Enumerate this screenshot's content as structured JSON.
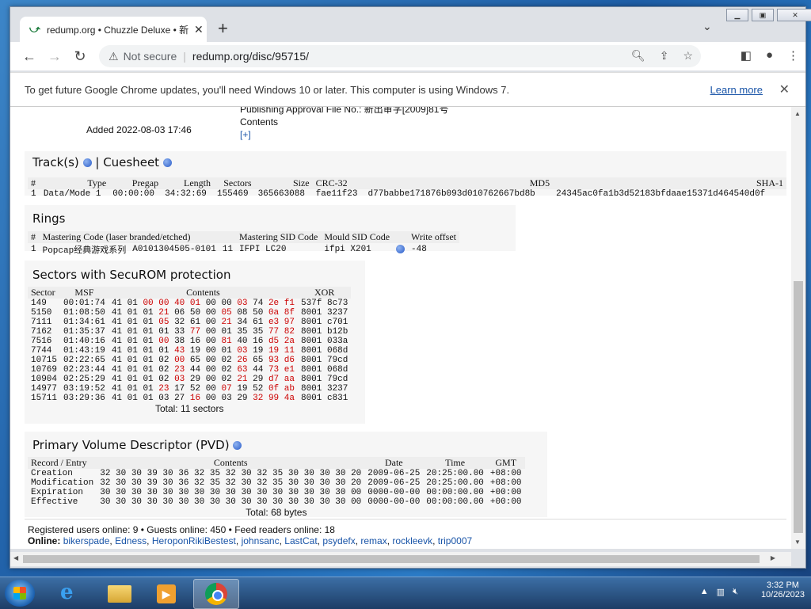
{
  "browser": {
    "tab_title": "redump.org • Chuzzle Deluxe • 新",
    "not_secure": "Not secure",
    "url": "redump.org/disc/95715/",
    "info_message": "To get future Google Chrome updates, you'll need Windows 10 or later. This computer is using Windows 7.",
    "learn_more": "Learn more"
  },
  "header_partial": {
    "publishing": "Publishing Approval File No.: 新出审字[2009]81号",
    "added_label": "Added",
    "added_value": "2022-08-03 17:46",
    "contents_label": "Contents",
    "contents_toggle": "[+]"
  },
  "tracks": {
    "title": "Track(s)",
    "sep": "|",
    "cuesheet": "Cuesheet",
    "headers": [
      "#",
      "Type",
      "Pregap",
      "Length",
      "Sectors",
      "Size",
      "CRC-32",
      "MD5",
      "SHA-1"
    ],
    "rows": [
      [
        "1",
        "Data/Mode 1",
        "00:00:00",
        "34:32:69",
        "155469",
        "365663088",
        "fae11f23",
        "d77babbe171876b093d010762667bd8b",
        "24345ac0fa1b3d52183bfdaae15371d464540d0f"
      ]
    ]
  },
  "rings": {
    "title": "Rings",
    "headers": [
      "#",
      "Mastering Code (laser branded/etched)",
      "",
      "",
      "Mastering SID Code",
      "Mould SID Code",
      "",
      "Write offset"
    ],
    "rows": [
      [
        "1",
        "Popcap经典游戏系列",
        "A0101304505-0101",
        "11",
        "IFPI LC20",
        "ifpi X201",
        "",
        "-48"
      ]
    ]
  },
  "securom": {
    "title": "Sectors with SecuROM protection",
    "headers": [
      "Sector",
      "MSF",
      "Contents",
      "XOR"
    ],
    "rows": [
      {
        "sector": "149",
        "msf": "00:01:74",
        "c": [
          [
            "41",
            0
          ],
          [
            "01",
            0
          ],
          [
            "00",
            1
          ],
          [
            "00",
            1
          ],
          [
            "40",
            1
          ],
          [
            "01",
            1
          ],
          [
            "00",
            0
          ],
          [
            "00",
            0
          ],
          [
            "03",
            1
          ],
          [
            "74",
            0
          ],
          [
            "2e",
            1
          ],
          [
            "f1",
            1
          ]
        ],
        "xor": "537f 8c73"
      },
      {
        "sector": "5150",
        "msf": "01:08:50",
        "c": [
          [
            "41",
            0
          ],
          [
            "01",
            0
          ],
          [
            "01",
            0
          ],
          [
            "21",
            1
          ],
          [
            "06",
            0
          ],
          [
            "50",
            0
          ],
          [
            "00",
            0
          ],
          [
            "05",
            1
          ],
          [
            "08",
            0
          ],
          [
            "50",
            0
          ],
          [
            "0a",
            1
          ],
          [
            "8f",
            1
          ]
        ],
        "xor": "8001 3237"
      },
      {
        "sector": "7111",
        "msf": "01:34:61",
        "c": [
          [
            "41",
            0
          ],
          [
            "01",
            0
          ],
          [
            "01",
            0
          ],
          [
            "05",
            1
          ],
          [
            "32",
            0
          ],
          [
            "61",
            0
          ],
          [
            "00",
            0
          ],
          [
            "21",
            1
          ],
          [
            "34",
            0
          ],
          [
            "61",
            0
          ],
          [
            "e3",
            1
          ],
          [
            "97",
            1
          ]
        ],
        "xor": "8001 c701"
      },
      {
        "sector": "7162",
        "msf": "01:35:37",
        "c": [
          [
            "41",
            0
          ],
          [
            "01",
            0
          ],
          [
            "01",
            0
          ],
          [
            "01",
            0
          ],
          [
            "33",
            0
          ],
          [
            "77",
            1
          ],
          [
            "00",
            0
          ],
          [
            "01",
            0
          ],
          [
            "35",
            0
          ],
          [
            "35",
            0
          ],
          [
            "77",
            1
          ],
          [
            "82",
            1
          ]
        ],
        "xor": "8001 b12b"
      },
      {
        "sector": "7516",
        "msf": "01:40:16",
        "c": [
          [
            "41",
            0
          ],
          [
            "01",
            0
          ],
          [
            "01",
            0
          ],
          [
            "00",
            1
          ],
          [
            "38",
            0
          ],
          [
            "16",
            0
          ],
          [
            "00",
            0
          ],
          [
            "81",
            1
          ],
          [
            "40",
            0
          ],
          [
            "16",
            0
          ],
          [
            "d5",
            1
          ],
          [
            "2a",
            1
          ]
        ],
        "xor": "8001 033a"
      },
      {
        "sector": "7744",
        "msf": "01:43:19",
        "c": [
          [
            "41",
            0
          ],
          [
            "01",
            0
          ],
          [
            "01",
            0
          ],
          [
            "01",
            0
          ],
          [
            "43",
            1
          ],
          [
            "19",
            0
          ],
          [
            "00",
            0
          ],
          [
            "01",
            0
          ],
          [
            "03",
            1
          ],
          [
            "19",
            0
          ],
          [
            "19",
            1
          ],
          [
            "11",
            1
          ]
        ],
        "xor": "8001 068d"
      },
      {
        "sector": "10715",
        "msf": "02:22:65",
        "c": [
          [
            "41",
            0
          ],
          [
            "01",
            0
          ],
          [
            "01",
            0
          ],
          [
            "02",
            0
          ],
          [
            "00",
            1
          ],
          [
            "65",
            0
          ],
          [
            "00",
            0
          ],
          [
            "02",
            0
          ],
          [
            "26",
            1
          ],
          [
            "65",
            0
          ],
          [
            "93",
            1
          ],
          [
            "d6",
            1
          ]
        ],
        "xor": "8001 79cd"
      },
      {
        "sector": "10769",
        "msf": "02:23:44",
        "c": [
          [
            "41",
            0
          ],
          [
            "01",
            0
          ],
          [
            "01",
            0
          ],
          [
            "02",
            0
          ],
          [
            "23",
            1
          ],
          [
            "44",
            0
          ],
          [
            "00",
            0
          ],
          [
            "02",
            0
          ],
          [
            "63",
            1
          ],
          [
            "44",
            0
          ],
          [
            "73",
            1
          ],
          [
            "e1",
            1
          ]
        ],
        "xor": "8001 068d"
      },
      {
        "sector": "10904",
        "msf": "02:25:29",
        "c": [
          [
            "41",
            0
          ],
          [
            "01",
            0
          ],
          [
            "01",
            0
          ],
          [
            "02",
            0
          ],
          [
            "03",
            1
          ],
          [
            "29",
            0
          ],
          [
            "00",
            0
          ],
          [
            "02",
            0
          ],
          [
            "21",
            1
          ],
          [
            "29",
            0
          ],
          [
            "d7",
            1
          ],
          [
            "aa",
            1
          ]
        ],
        "xor": "8001 79cd"
      },
      {
        "sector": "14977",
        "msf": "03:19:52",
        "c": [
          [
            "41",
            0
          ],
          [
            "01",
            0
          ],
          [
            "01",
            0
          ],
          [
            "23",
            1
          ],
          [
            "17",
            0
          ],
          [
            "52",
            0
          ],
          [
            "00",
            0
          ],
          [
            "07",
            1
          ],
          [
            "19",
            0
          ],
          [
            "52",
            0
          ],
          [
            "0f",
            1
          ],
          [
            "ab",
            1
          ]
        ],
        "xor": "8001 3237"
      },
      {
        "sector": "15711",
        "msf": "03:29:36",
        "c": [
          [
            "41",
            0
          ],
          [
            "01",
            0
          ],
          [
            "01",
            0
          ],
          [
            "03",
            0
          ],
          [
            "27",
            0
          ],
          [
            "16",
            1
          ],
          [
            "00",
            0
          ],
          [
            "03",
            0
          ],
          [
            "29",
            0
          ],
          [
            "32",
            1
          ],
          [
            "99",
            1
          ],
          [
            "4a",
            1
          ]
        ],
        "xor": "8001 c831"
      }
    ],
    "total": "Total: 11 sectors"
  },
  "pvd": {
    "title": "Primary Volume Descriptor (PVD)",
    "headers": [
      "Record / Entry",
      "Contents",
      "Date",
      "Time",
      "GMT"
    ],
    "rows": [
      [
        "Creation",
        "32 30 30 39 30 36 32 35 32 30 32 35 30 30 30 30 20",
        "2009-06-25",
        "20:25:00.00",
        "+08:00"
      ],
      [
        "Modification",
        "32 30 30 39 30 36 32 35 32 30 32 35 30 30 30 30 20",
        "2009-06-25",
        "20:25:00.00",
        "+08:00"
      ],
      [
        "Expiration",
        "30 30 30 30 30 30 30 30 30 30 30 30 30 30 30 30 00",
        "0000-00-00",
        "00:00:00.00",
        "+00:00"
      ],
      [
        "Effective",
        "30 30 30 30 30 30 30 30 30 30 30 30 30 30 30 30 00",
        "0000-00-00",
        "00:00:00.00",
        "+00:00"
      ]
    ],
    "total": "Total: 68 bytes"
  },
  "footer": {
    "stats": "Registered users online: 9 • Guests online: 450 • Feed readers online: 18",
    "online_label": "Online:",
    "users": [
      "bikerspade",
      "Edness",
      "HeroponRikiBestest",
      "johnsanc",
      "LastCat",
      "psydefx",
      "remax",
      "rockleevk",
      "trip0007"
    ]
  },
  "taskbar": {
    "time": "3:32 PM",
    "date": "10/26/2023"
  }
}
